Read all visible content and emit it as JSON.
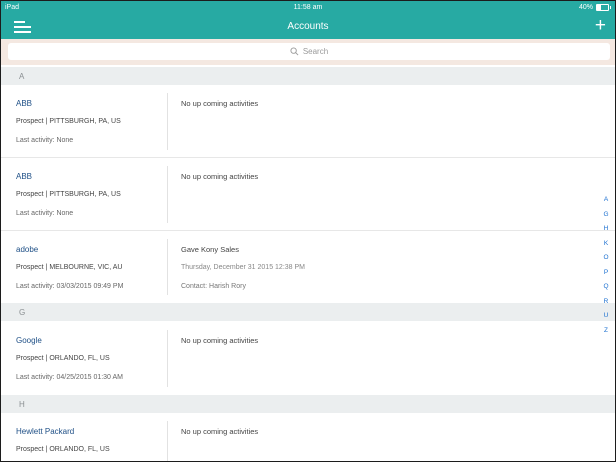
{
  "status_bar": {
    "carrier": "iPad",
    "time": "11:58 am",
    "battery": "40%"
  },
  "nav": {
    "title": "Accounts",
    "menu_icon": "hamburger-menu-icon",
    "add_icon": "plus-icon"
  },
  "search": {
    "placeholder": "Search"
  },
  "sections": [
    {
      "letter": "A"
    },
    {
      "letter": "G"
    },
    {
      "letter": "H"
    }
  ],
  "accounts": [
    {
      "name": "ABB",
      "meta": "Prospect | PITTSBURGH, PA, US",
      "last_activity": "Last activity: None",
      "activity": "No up coming activities",
      "activity_date": "",
      "activity_contact": ""
    },
    {
      "name": "ABB",
      "meta": "Prospect | PITTSBURGH, PA, US",
      "last_activity": "Last activity: None",
      "activity": "No up coming activities",
      "activity_date": "",
      "activity_contact": ""
    },
    {
      "name": "adobe",
      "meta": "Prospect | MELBOURNE, VIC, AU",
      "last_activity": "Last activity: 03/03/2015 09:49 PM",
      "activity": "Gave Kony Sales",
      "activity_date": "Thursday, December 31 2015 12:38 PM",
      "activity_contact": "Contact: Harish Rory"
    },
    {
      "name": "Google",
      "meta": "Prospect | ORLANDO, FL, US",
      "last_activity": "Last activity: 04/25/2015 01:30 AM",
      "activity": "No up coming activities",
      "activity_date": "",
      "activity_contact": ""
    },
    {
      "name": "Hewlett Packard",
      "meta": "Prospect | ORLANDO, FL, US",
      "last_activity": "",
      "activity": "No up coming activities",
      "activity_date": "",
      "activity_contact": ""
    }
  ],
  "alpha_index": [
    "A",
    "G",
    "H",
    "K",
    "O",
    "P",
    "Q",
    "R",
    "U",
    "Z"
  ],
  "colors": {
    "accent": "#27aaa3",
    "link": "#1e4f86",
    "index": "#1a6fd0",
    "section_bg": "#ebeeef"
  }
}
